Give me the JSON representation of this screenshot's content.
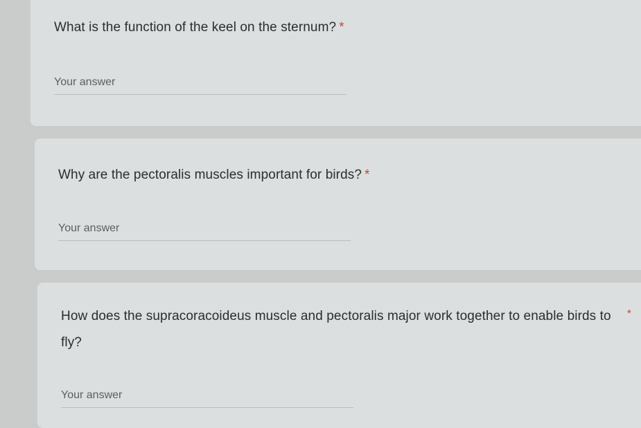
{
  "questions": [
    {
      "text": "What is the function of the keel on the sternum?",
      "required_mark": "*",
      "answer_placeholder": "Your answer"
    },
    {
      "text": "Why are the pectoralis muscles important for birds?",
      "required_mark": "*",
      "answer_placeholder": "Your answer"
    },
    {
      "text": "How does the supracoracoideus muscle and pectoralis major work together to enable birds to fly?",
      "required_mark": "*",
      "answer_placeholder": "Your answer"
    }
  ],
  "colors": {
    "background": "#c9cccb",
    "card": "#dcdfdf",
    "required": "#c6453c"
  }
}
